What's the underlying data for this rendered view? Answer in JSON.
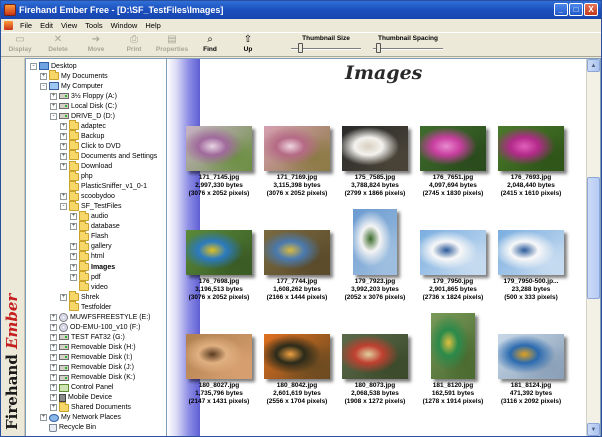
{
  "window": {
    "title": "Firehand Ember Free - [D:\\SF_TestFiles\\Images]",
    "minimize": "_",
    "maximize": "□",
    "close": "X"
  },
  "menu": [
    "File",
    "Edit",
    "View",
    "Tools",
    "Window",
    "Help"
  ],
  "toolbar": {
    "buttons": [
      {
        "label": "Display",
        "icon": "display-icon",
        "glyph": "▭"
      },
      {
        "label": "Delete",
        "icon": "delete-icon",
        "glyph": "✕"
      },
      {
        "label": "Move",
        "icon": "move-icon",
        "glyph": "➔"
      },
      {
        "label": "Print",
        "icon": "print-icon",
        "glyph": "⎙"
      },
      {
        "label": "Properties",
        "icon": "properties-icon",
        "glyph": "▤"
      },
      {
        "label": "Find",
        "icon": "find-icon",
        "glyph": "⌕"
      },
      {
        "label": "Up",
        "icon": "up-folder-icon",
        "glyph": "⇧"
      }
    ],
    "thumbnail_size_label": "Thumbnail Size",
    "thumbnail_spacing_label": "Thumbnail Spacing",
    "thumbnail_size_level": 0.1,
    "thumbnail_spacing_level": 0.05
  },
  "brand": {
    "part1": "Firehand",
    "part2": "Ember",
    "accent": "#c41e1e"
  },
  "tree": [
    {
      "label": "Desktop",
      "depth": 0,
      "icon": "desktop",
      "exp": "-"
    },
    {
      "label": "My Documents",
      "depth": 1,
      "icon": "folder",
      "exp": "+"
    },
    {
      "label": "My Computer",
      "depth": 1,
      "icon": "computer",
      "exp": "-"
    },
    {
      "label": "3½ Floppy (A:)",
      "depth": 2,
      "icon": "drive",
      "exp": "+"
    },
    {
      "label": "Local Disk (C:)",
      "depth": 2,
      "icon": "drive",
      "exp": "+"
    },
    {
      "label": "DRIVE_D (D:)",
      "depth": 2,
      "icon": "drive",
      "exp": "-"
    },
    {
      "label": "adaptec",
      "depth": 3,
      "icon": "folder",
      "exp": "+"
    },
    {
      "label": "Backup",
      "depth": 3,
      "icon": "folder",
      "exp": "+"
    },
    {
      "label": "Click to DVD",
      "depth": 3,
      "icon": "folder",
      "exp": "+"
    },
    {
      "label": "Documents and Settings",
      "depth": 3,
      "icon": "folder",
      "exp": "+"
    },
    {
      "label": "Download",
      "depth": 3,
      "icon": "folder",
      "exp": "+"
    },
    {
      "label": "php",
      "depth": 3,
      "icon": "folder",
      "exp": ""
    },
    {
      "label": "PlasticSniffer_v1_0-1",
      "depth": 3,
      "icon": "folder",
      "exp": ""
    },
    {
      "label": "scoobydoo",
      "depth": 3,
      "icon": "folder",
      "exp": "+"
    },
    {
      "label": "SF_TestFiles",
      "depth": 3,
      "icon": "folder",
      "exp": "-"
    },
    {
      "label": "audio",
      "depth": 4,
      "icon": "folder",
      "exp": "+"
    },
    {
      "label": "database",
      "depth": 4,
      "icon": "folder",
      "exp": "+"
    },
    {
      "label": "Flash",
      "depth": 4,
      "icon": "folder",
      "exp": ""
    },
    {
      "label": "gallery",
      "depth": 4,
      "icon": "folder",
      "exp": "+"
    },
    {
      "label": "html",
      "depth": 4,
      "icon": "folder",
      "exp": "+"
    },
    {
      "label": "Images",
      "depth": 4,
      "icon": "folder",
      "exp": "+",
      "bold": true
    },
    {
      "label": "pdf",
      "depth": 4,
      "icon": "folder",
      "exp": "+"
    },
    {
      "label": "video",
      "depth": 4,
      "icon": "folder",
      "exp": ""
    },
    {
      "label": "Shrek",
      "depth": 3,
      "icon": "folder",
      "exp": "+"
    },
    {
      "label": "Testfolder",
      "depth": 3,
      "icon": "folder",
      "exp": ""
    },
    {
      "label": "MUWFSFREESTYLE (E:)",
      "depth": 2,
      "icon": "cd",
      "exp": "+"
    },
    {
      "label": "OD-EMU-100_v10 (F:)",
      "depth": 2,
      "icon": "cd",
      "exp": "+"
    },
    {
      "label": "TEST FAT32 (G:)",
      "depth": 2,
      "icon": "drive",
      "exp": "+"
    },
    {
      "label": "Removable Disk (H:)",
      "depth": 2,
      "icon": "drive",
      "exp": "+"
    },
    {
      "label": "Removable Disk (I:)",
      "depth": 2,
      "icon": "drive",
      "exp": "+"
    },
    {
      "label": "Removable Disk (J:)",
      "depth": 2,
      "icon": "drive",
      "exp": "+"
    },
    {
      "label": "Removable Disk (K:)",
      "depth": 2,
      "icon": "drive",
      "exp": "+"
    },
    {
      "label": "Control Panel",
      "depth": 2,
      "icon": "panel",
      "exp": "+"
    },
    {
      "label": "Mobile Device",
      "depth": 2,
      "icon": "phone",
      "exp": "+"
    },
    {
      "label": "Shared Documents",
      "depth": 2,
      "icon": "folder",
      "exp": "+"
    },
    {
      "label": "My Network Places",
      "depth": 1,
      "icon": "network",
      "exp": "+"
    },
    {
      "label": "Recycle Bin",
      "depth": 1,
      "icon": "recycle",
      "exp": ""
    }
  ],
  "viewer": {
    "title": "Images",
    "thumbnails": [
      {
        "name": "171_7145.jpg",
        "size": "2,997,330 bytes",
        "dims": "(3076 x 2052 pixels)",
        "palette": [
          "#c9b3c7",
          "#a06a9c",
          "#e7d5e2",
          "#6d8f44"
        ]
      },
      {
        "name": "171_7169.jpg",
        "size": "3,115,398 bytes",
        "dims": "(3076 x 2052 pixels)",
        "palette": [
          "#d8a0b3",
          "#b56a86",
          "#f0d5de",
          "#8b7a44"
        ]
      },
      {
        "name": "175_7585.jpg",
        "size": "3,788,824 bytes",
        "dims": "(2799 x 1866 pixels)",
        "palette": [
          "#2a2a2a",
          "#f4f2ee",
          "#d8d0c0",
          "#4a4438"
        ]
      },
      {
        "name": "176_7651.jpg",
        "size": "4,097,694 bytes",
        "dims": "(2745 x 1830 pixels)",
        "palette": [
          "#3e6d2c",
          "#c93fa0",
          "#e88ad0",
          "#2a4a1c"
        ]
      },
      {
        "name": "176_7693.jpg",
        "size": "2,048,440 bytes",
        "dims": "(2415 x 1610 pixels)",
        "palette": [
          "#4a7a2a",
          "#b32a8a",
          "#e060b8",
          "#2e5418"
        ]
      },
      {
        "name": "176_7698.jpg",
        "size": "3,196,513 bytes",
        "dims": "(3076 x 2052 pixels)",
        "palette": [
          "#5a8a3a",
          "#2a7ac0",
          "#e0c020",
          "#3a5a24"
        ]
      },
      {
        "name": "177_7744.jpg",
        "size": "1,608,262 bytes",
        "dims": "(2166 x 1444 pixels)",
        "palette": [
          "#7a6a40",
          "#4a7ab0",
          "#d8b840",
          "#5a4a2a"
        ]
      },
      {
        "name": "179_7923.jpg",
        "size": "3,992,203 bytes",
        "dims": "(2052 x 3076 pixels)",
        "palette": [
          "#6a9ad0",
          "#f4f4f4",
          "#3a6a2a",
          "#a0c0e0"
        ]
      },
      {
        "name": "179_7950.jpg",
        "size": "2,901,865 bytes",
        "dims": "(2736 x 1824 pixels)",
        "palette": [
          "#7aaee0",
          "#f8f8f8",
          "#2a5a9a",
          "#c8dcf0"
        ]
      },
      {
        "name": "179_7950-500.jp...",
        "size": "23,288 bytes",
        "dims": "(500 x 333 pixels)",
        "palette": [
          "#7aaee0",
          "#f8f8f8",
          "#2a5a9a",
          "#c8dcf0"
        ]
      },
      {
        "name": "180_8027.jpg",
        "size": "1,735,796 bytes",
        "dims": "(2147 x 1431 pixels)",
        "palette": [
          "#b08050",
          "#e0b080",
          "#5a3a20",
          "#d8a070"
        ]
      },
      {
        "name": "180_8042.jpg",
        "size": "2,601,619 bytes",
        "dims": "(2556 x 1704 pixels)",
        "palette": [
          "#e07020",
          "#2a2a1a",
          "#f0a040",
          "#6a4a20"
        ]
      },
      {
        "name": "180_8073.jpg",
        "size": "2,068,538 bytes",
        "dims": "(1908 x 1272 pixels)",
        "palette": [
          "#5a6a4a",
          "#c04030",
          "#e0d0a0",
          "#3a4a2a"
        ]
      },
      {
        "name": "181_8120.jpg",
        "size": "162,591 bytes",
        "dims": "(1278 x 1914 pixels)",
        "palette": [
          "#7a9a5a",
          "#2a8a4a",
          "#e0c040",
          "#4a6a30"
        ]
      },
      {
        "name": "181_8124.jpg",
        "size": "471,392 bytes",
        "dims": "(3116 x 2092 pixels)",
        "palette": [
          "#c8d8e8",
          "#2a6ab0",
          "#e0a020",
          "#8aa0b8"
        ]
      }
    ]
  },
  "scrollbar": {
    "up": "▲",
    "down": "▼"
  }
}
